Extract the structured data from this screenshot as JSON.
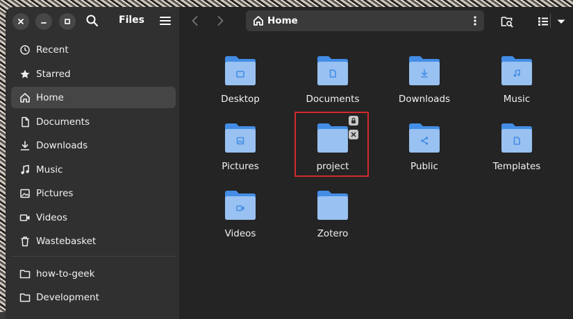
{
  "sidebar": {
    "title": "Files",
    "window_controls": [
      {
        "name": "close-icon"
      },
      {
        "name": "minimize-icon"
      },
      {
        "name": "maximize-icon"
      }
    ],
    "items": [
      {
        "label": "Recent",
        "icon": "clock-icon",
        "active": false
      },
      {
        "label": "Starred",
        "icon": "star-icon",
        "active": false
      },
      {
        "label": "Home",
        "icon": "home-icon",
        "active": true
      },
      {
        "label": "Documents",
        "icon": "document-icon",
        "active": false
      },
      {
        "label": "Downloads",
        "icon": "download-icon",
        "active": false
      },
      {
        "label": "Music",
        "icon": "music-icon",
        "active": false
      },
      {
        "label": "Pictures",
        "icon": "picture-icon",
        "active": false
      },
      {
        "label": "Videos",
        "icon": "video-icon",
        "active": false
      },
      {
        "label": "Wastebasket",
        "icon": "trash-icon",
        "active": false
      }
    ],
    "bookmarks": [
      {
        "label": "how-to-geek",
        "icon": "folder-icon"
      },
      {
        "label": "Development",
        "icon": "folder-icon"
      }
    ]
  },
  "toolbar": {
    "path_label": "Home",
    "path_icon": "home-icon"
  },
  "folders": [
    {
      "label": "Desktop",
      "emblem": "desktop"
    },
    {
      "label": "Documents",
      "emblem": "document"
    },
    {
      "label": "Downloads",
      "emblem": "download"
    },
    {
      "label": "Music",
      "emblem": "music"
    },
    {
      "label": "Pictures",
      "emblem": "picture"
    },
    {
      "label": "project",
      "emblem": "none",
      "selected_highlight": true,
      "badges": [
        "lock-icon",
        "unreadable-x-icon"
      ]
    },
    {
      "label": "Public",
      "emblem": "share"
    },
    {
      "label": "Templates",
      "emblem": "document"
    },
    {
      "label": "Videos",
      "emblem": "video"
    },
    {
      "label": "Zotero",
      "emblem": "none"
    }
  ],
  "colors": {
    "folder_back": "#438de6",
    "folder_front": "#99c1f1",
    "highlight": "#d52a2a",
    "sidebar_bg": "#303030",
    "main_bg": "#242424"
  }
}
